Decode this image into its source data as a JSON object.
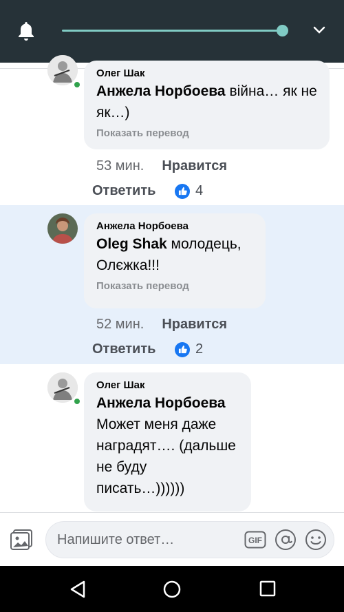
{
  "status_bar": {
    "icons": [
      "bell-icon",
      "chevron-down-icon"
    ],
    "slider_level": 1.0
  },
  "comments": [
    {
      "author": "Олег Шак",
      "mention": "Анжела Норбоева",
      "text": " війна… як не як…)",
      "translate": "Показать перевод",
      "time": "53 мин.",
      "like_label": "Нравится",
      "reply_label": "Ответить",
      "likes": "4"
    },
    {
      "author": "Анжела Норбоева",
      "mention": "Oleg Shak",
      "text": " молодець, Олєжка!!!",
      "translate": "Показать перевод",
      "time": "52 мин.",
      "like_label": "Нравится",
      "reply_label": "Ответить",
      "likes": "2"
    },
    {
      "author": "Олег Шак",
      "mention": "Анжела Норбоева",
      "text": "Может меня даже наградят…. (дальше не буду писать…))))))"
    }
  ],
  "composer": {
    "placeholder": "Напишите ответ…",
    "gif_label": "GIF"
  },
  "colors": {
    "accent": "#1877f2",
    "topbar": "#263238",
    "slider": "#80cbc4",
    "highlight": "#e7f0fb"
  }
}
